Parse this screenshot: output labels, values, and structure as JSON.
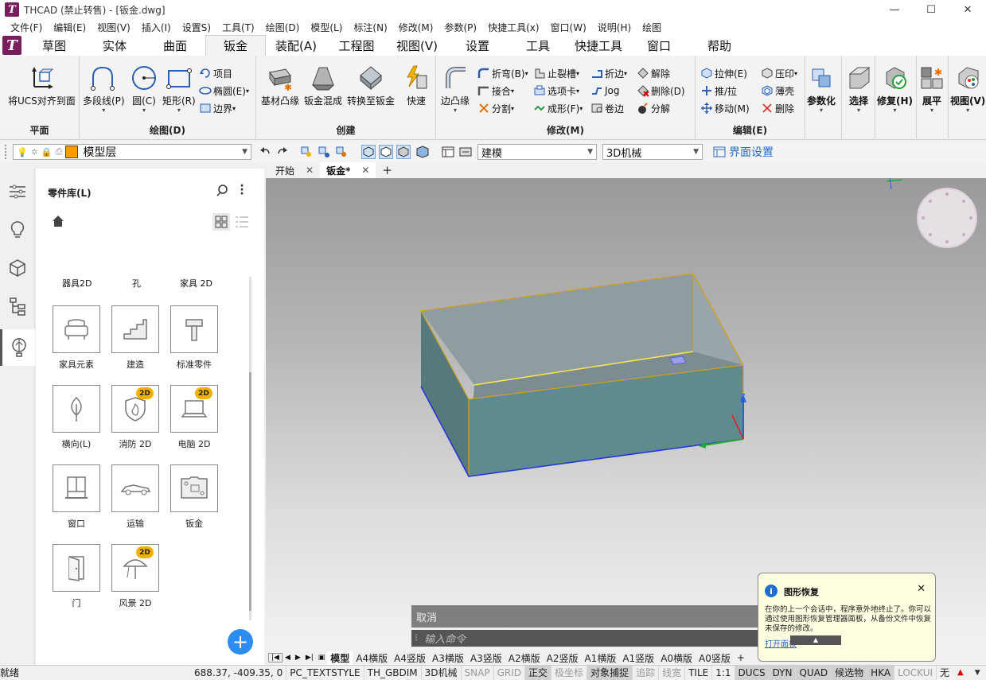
{
  "titlebar": {
    "title": "THCAD (禁止转售) - [钣金.dwg]",
    "minimize": "—",
    "maximize": "☐",
    "close": "✕"
  },
  "menu": [
    "文件(F)",
    "编辑(E)",
    "视图(V)",
    "插入(I)",
    "设置S)",
    "工具(T)",
    "绘图(D)",
    "模型(L)",
    "标注(N)",
    "修改(M)",
    "参数(P)",
    "快捷工具(x)",
    "窗口(W)",
    "说明(H)",
    "绘图"
  ],
  "ribbon_tabs": [
    "草图",
    "实体",
    "曲面",
    "钣金",
    "装配(A)",
    "工程图",
    "视图(V)",
    "设置",
    "工具",
    "快捷工具",
    "窗口",
    "帮助"
  ],
  "active_tab": "钣金",
  "panels": {
    "plane": {
      "label": "平面",
      "btn": "将UCS对齐到面"
    },
    "draw": {
      "label": "绘图(D)",
      "polyline": "多段线(P)",
      "circle": "圆(C)",
      "rect": "矩形(R)",
      "item": "项目",
      "ellipse": "椭圆(E)",
      "boundary": "边界"
    },
    "create": {
      "label": "创建",
      "base_flange": "基材凸缘",
      "lofted": "钣金混成",
      "convert": "转换至钣金",
      "quick": "快速"
    },
    "modify": {
      "label": "修改(M)",
      "edge_flange": "边凸缘",
      "bend": "折弯(B)",
      "joint": "接合",
      "split": "分割",
      "relief": "止裂槽",
      "tab_option": "选项卡",
      "form": "成形(F)",
      "hem": "折边",
      "jog": "Jog",
      "rolled": "卷边",
      "unfold": "解除",
      "delete": "删除(D)",
      "explode": "分解"
    },
    "edit": {
      "label": "编辑(E)",
      "extrude": "拉伸(E)",
      "pushpull": "推/拉",
      "move": "移动(M)",
      "emboss": "压印",
      "shell": "薄壳",
      "delete": "删除"
    },
    "big": {
      "param": "参数化",
      "select": "选择",
      "repair": "修复(H)",
      "unfold": "展平",
      "view": "视图(V)"
    }
  },
  "toolbar2": {
    "layer": "模型层",
    "workspace": "建模",
    "visual_style": "3D机械",
    "ui_settings": "界面设置"
  },
  "doc_tabs": [
    "开始",
    "钣金*"
  ],
  "library": {
    "title": "零件库(L)",
    "row0": [
      "器具2D",
      "孔",
      "家具 2D"
    ],
    "items": [
      {
        "name": "家具元素",
        "badge": ""
      },
      {
        "name": "建造",
        "badge": ""
      },
      {
        "name": "标准零件",
        "badge": ""
      },
      {
        "name": "横向(L)",
        "badge": ""
      },
      {
        "name": "消防 2D",
        "badge": "2D"
      },
      {
        "name": "电脑 2D",
        "badge": "2D"
      },
      {
        "name": "窗口",
        "badge": ""
      },
      {
        "name": "运输",
        "badge": ""
      },
      {
        "name": "钣金",
        "badge": ""
      },
      {
        "name": "门",
        "badge": ""
      },
      {
        "name": "风景 2D",
        "badge": "2D"
      }
    ],
    "add": "+"
  },
  "command": {
    "history": "取消",
    "prompt": "输入命令"
  },
  "layout_tabs": [
    "模型",
    "A4横版",
    "A4竖版",
    "A3横版",
    "A3竖版",
    "A2横版",
    "A2竖版",
    "A1横版",
    "A1竖版",
    "A0横版",
    "A0竖版",
    "+"
  ],
  "status": {
    "ready": "就绪",
    "coords": "688.37, -409.35, 0",
    "items": [
      {
        "t": "PC_TEXTSTYLE",
        "s": "n"
      },
      {
        "t": "TH_GBDIM",
        "s": "n"
      },
      {
        "t": "3D机械",
        "s": "n"
      },
      {
        "t": "SNAP",
        "s": "off"
      },
      {
        "t": "GRID",
        "s": "off"
      },
      {
        "t": "正交",
        "s": "on"
      },
      {
        "t": "极坐标",
        "s": "off"
      },
      {
        "t": "对象捕捉",
        "s": "on"
      },
      {
        "t": "追踪",
        "s": "off"
      },
      {
        "t": "线宽",
        "s": "off"
      },
      {
        "t": "TILE",
        "s": "n"
      },
      {
        "t": "1:1",
        "s": "n"
      },
      {
        "t": "DUCS",
        "s": "on"
      },
      {
        "t": "DYN",
        "s": "on"
      },
      {
        "t": "QUAD",
        "s": "on"
      },
      {
        "t": "候选物",
        "s": "on"
      },
      {
        "t": "HKA",
        "s": "on"
      },
      {
        "t": "LOCKUI",
        "s": "off"
      },
      {
        "t": "无",
        "s": "n"
      }
    ]
  },
  "balloon": {
    "title": "图形恢复",
    "body": "在你的上一个会话中，程序意外地终止了。你可以通过使用图形恢复管理器面板，从备份文件中恢复未保存的修改。",
    "link": "打开面板"
  },
  "colors": {
    "accent": "#7a1f5e",
    "box_face": "#5f8a8e",
    "box_inner": "#8f9ca0",
    "edge": "#d4a017",
    "plus_btn": "#2d8cf0",
    "badge": "#f2b000"
  }
}
